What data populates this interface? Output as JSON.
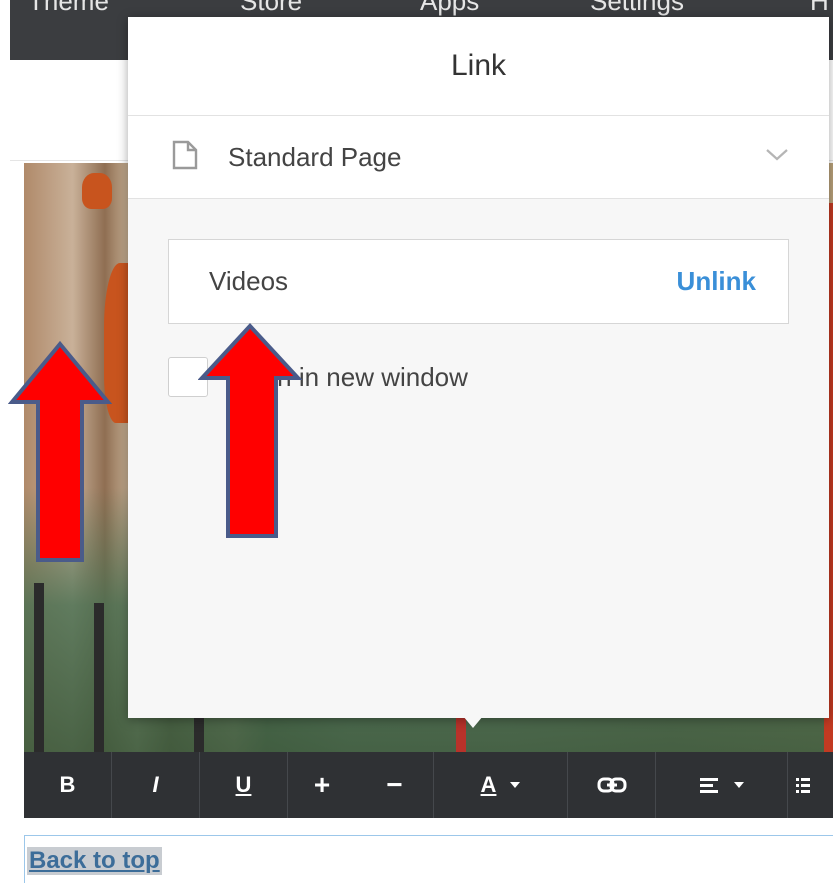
{
  "topnav": {
    "items": [
      "Theme",
      "Store",
      "Apps",
      "Settings",
      "H"
    ]
  },
  "popup": {
    "title": "Link",
    "page_type": "Standard Page",
    "link_value": "Videos",
    "unlink_label": "Unlink",
    "new_window_label": "Open in new window",
    "new_window_checked": false
  },
  "annotations": {
    "arrow_color": "#ff0000",
    "arrow_border": "#4a5b8a"
  },
  "toolbar": {
    "bold": "B",
    "italic": "I",
    "underline": "U",
    "increase": "+",
    "decrease": "−",
    "font_color": "A",
    "link_icon": "link-icon",
    "align_icon": "align-left-icon",
    "list_icon": "list-icon"
  },
  "footer": {
    "back_to_top": "Back to top"
  }
}
